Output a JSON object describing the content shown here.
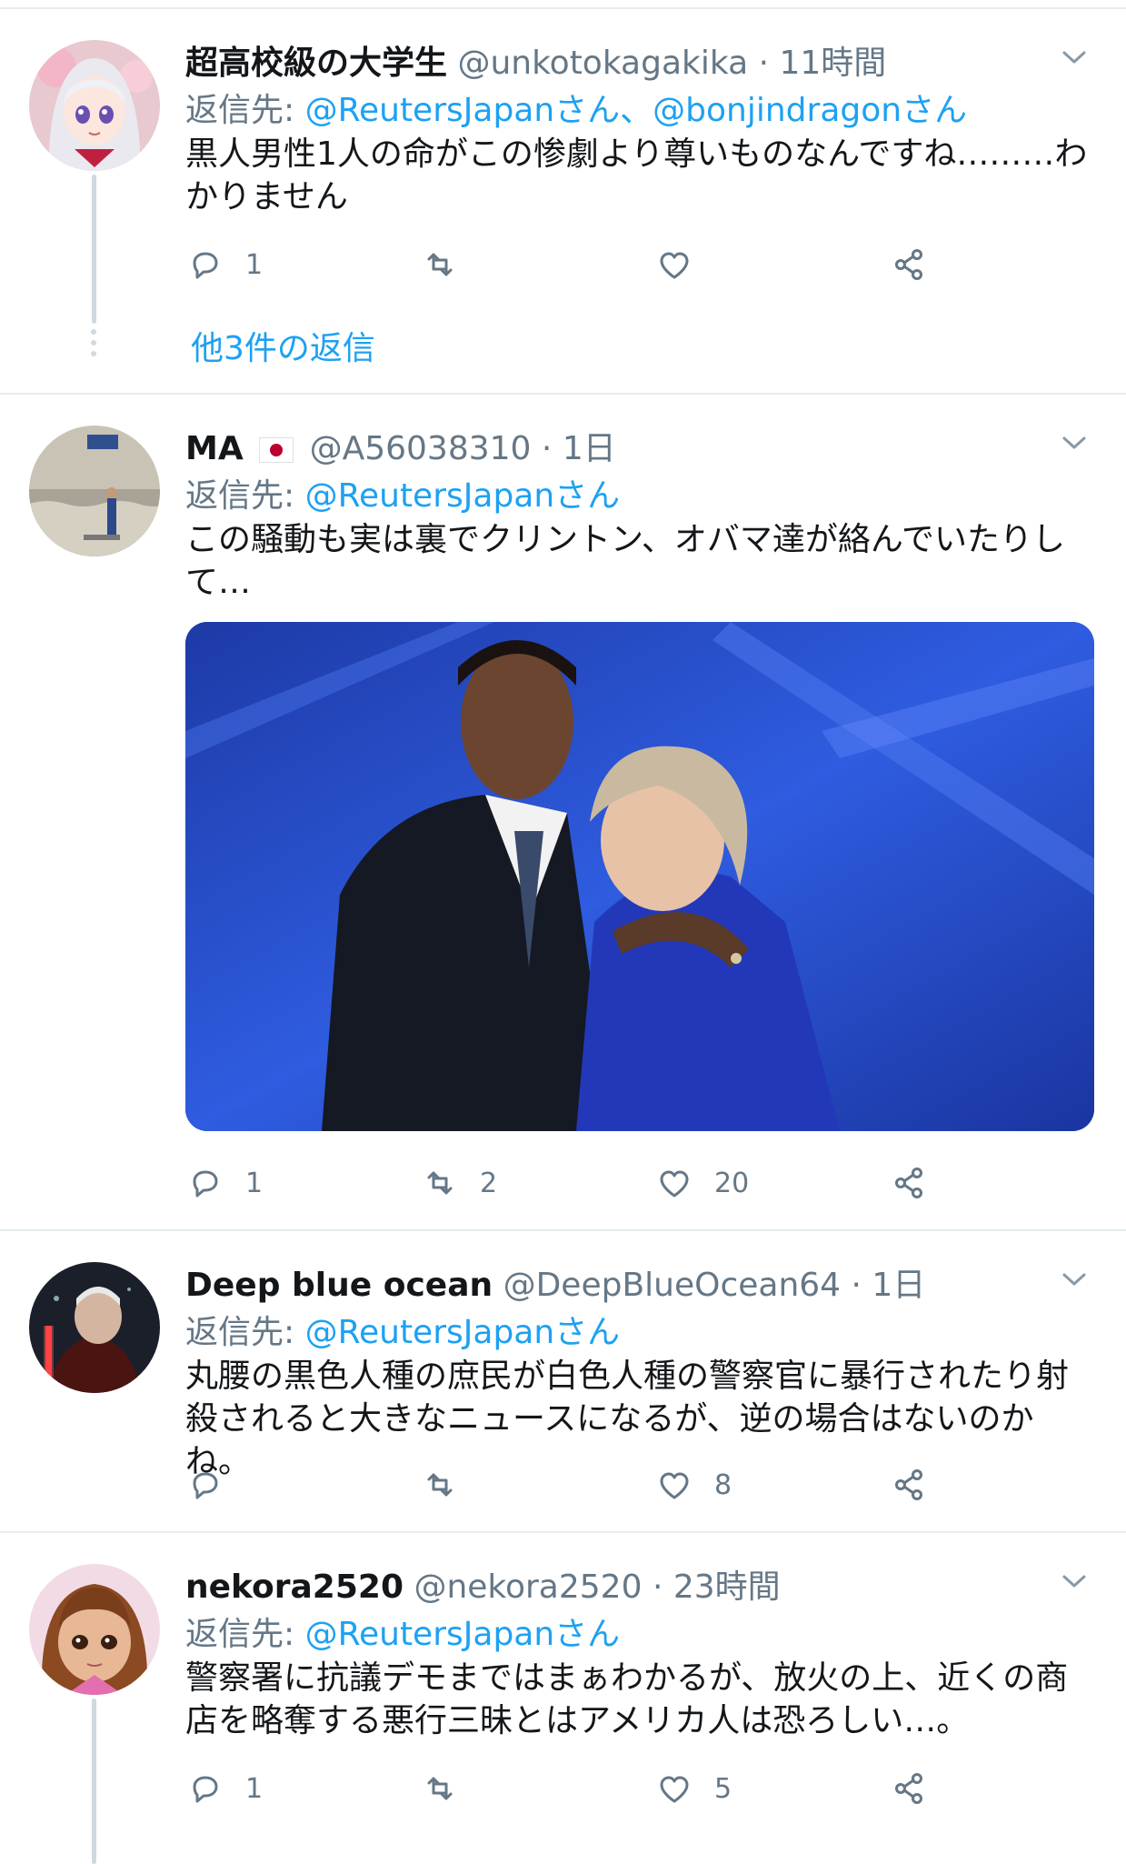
{
  "tweets": [
    {
      "name": "超高校級の大学生",
      "handle": "@unkotokagakika",
      "time": "11時間",
      "reply_prefix": "返信先: ",
      "reply_to": "@ReutersJapanさん、@bonjindragonさん",
      "text": "黒人男性1人の命がこの惨劇より尊いものなんですね………わかりません",
      "replies": "1",
      "retweets": "",
      "likes": "",
      "more_replies": "他3件の返信"
    },
    {
      "name": "MA",
      "handle": "@A56038310",
      "time": "1日",
      "reply_prefix": "返信先: ",
      "reply_to": "@ReutersJapanさん",
      "text": "この騒動も実は裏でクリントン、オバマ達が絡んでいたりして…",
      "replies": "1",
      "retweets": "2",
      "likes": "20"
    },
    {
      "name": "Deep blue ocean",
      "handle": "@DeepBlueOcean64",
      "time": "1日",
      "reply_prefix": "返信先: ",
      "reply_to": "@ReutersJapanさん",
      "text": "丸腰の黒色人種の庶民が白色人種の警察官に暴行されたり射殺されると大きなニュースになるが、逆の場合はないのかね。",
      "replies": "",
      "retweets": "",
      "likes": "8"
    },
    {
      "name": "nekora2520",
      "handle": "@nekora2520",
      "time": "23時間",
      "reply_prefix": "返信先: ",
      "reply_to": "@ReutersJapanさん",
      "text": "警察署に抗議デモまではまぁわかるが、放火の上、近くの商店を略奪する悪行三昧とはアメリカ人は恐ろしい…。",
      "replies": "1",
      "retweets": "",
      "likes": "5"
    }
  ],
  "separator": " · ",
  "colors": {
    "link": "#1da1f2",
    "muted": "#657786",
    "divider": "#e6ecf0",
    "flag_red": "#bc002d"
  },
  "icons": [
    "reply-icon",
    "retweet-icon",
    "like-icon",
    "share-icon",
    "chevron-down-icon",
    "japan-flag-icon"
  ]
}
